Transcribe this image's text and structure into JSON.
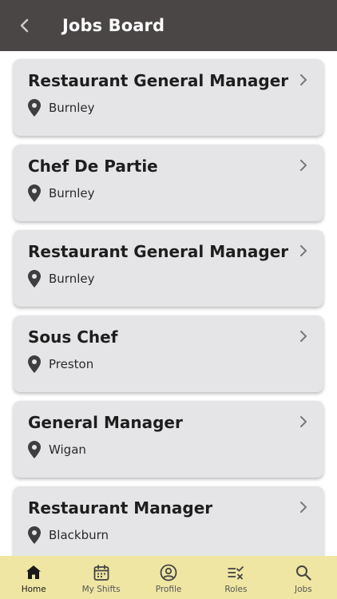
{
  "header": {
    "title": "Jobs Board",
    "back_icon": "chevron-left-icon"
  },
  "jobs": [
    {
      "title": "Restaurant General Manager",
      "location": "Burnley"
    },
    {
      "title": "Chef De Partie",
      "location": "Burnley"
    },
    {
      "title": "Restaurant General Manager",
      "location": "Burnley"
    },
    {
      "title": "Sous Chef",
      "location": "Preston"
    },
    {
      "title": "General Manager",
      "location": "Wigan"
    },
    {
      "title": "Restaurant Manager",
      "location": "Blackburn"
    }
  ],
  "tabs": [
    {
      "label": "Home",
      "icon": "home-icon",
      "active": true
    },
    {
      "label": "My Shifts",
      "icon": "calendar-icon",
      "active": false
    },
    {
      "label": "Profile",
      "icon": "profile-icon",
      "active": false
    },
    {
      "label": "Roles",
      "icon": "roles-icon",
      "active": false
    },
    {
      "label": "Jobs",
      "icon": "search-icon",
      "active": false
    }
  ],
  "colors": {
    "header_bg": "#4a4646",
    "card_bg": "#e5e5e7",
    "tabbar_bg": "#efe6a4"
  }
}
